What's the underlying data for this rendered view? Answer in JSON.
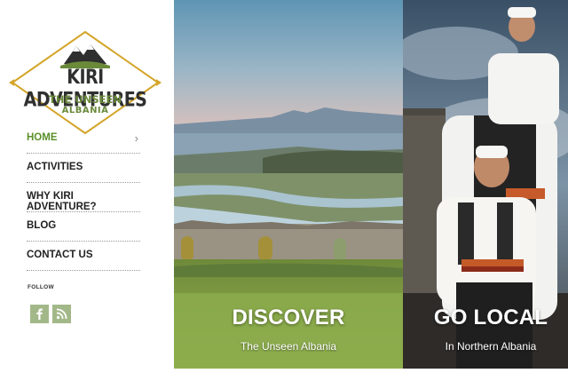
{
  "logo": {
    "title": "KIRI ADVENTURES",
    "subtitle_1": "THE UNSEEN",
    "subtitle_2": "ALBANIA"
  },
  "nav": {
    "items": [
      {
        "label": "HOME",
        "active": true
      },
      {
        "label": "ACTIVITIES",
        "active": false
      },
      {
        "label": "WHY KIRI ADVENTURE?",
        "active": false
      },
      {
        "label": "BLOG",
        "active": false
      },
      {
        "label": "CONTACT US",
        "active": false
      }
    ],
    "chevron": "›"
  },
  "follow": {
    "label": "FOLLOW",
    "icons": [
      "facebook-icon",
      "rss-icon"
    ]
  },
  "panels": [
    {
      "title": "DISCOVER",
      "subtitle": "The Unseen Albania"
    },
    {
      "title": "GO LOCAL",
      "subtitle": "In Northern Albania"
    }
  ],
  "colors": {
    "accent_green": "#5a8f2a",
    "social_bg": "#a3b889",
    "logo_gold": "#d4a52a"
  }
}
